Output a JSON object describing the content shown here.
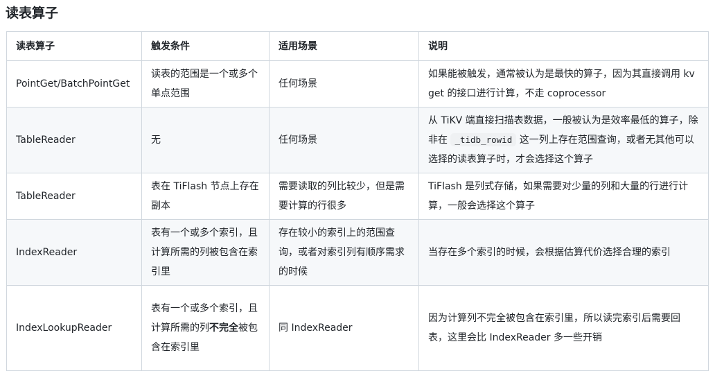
{
  "title": "读表算子",
  "headers": [
    "读表算子",
    "触发条件",
    "适用场景",
    "说明"
  ],
  "rows": [
    {
      "operator": "PointGet/BatchPointGet",
      "condition": "读表的范围是一个或多个单点范围",
      "scenario": "任何场景",
      "description": "如果能被触发，通常被认为是最快的算子，因为其直接调用 kvget 的接口进行计算，不走 coprocessor"
    },
    {
      "operator": "TableReader",
      "condition": "无",
      "scenario": "任何场景",
      "description_before": "从 TiKV 端直接扫描表数据，一般被认为是效率最低的算子，除非在 ",
      "description_code": "_tidb_rowid",
      "description_after": " 这一列上存在范围查询，或者无其他可以选择的读表算子时，才会选择这个算子"
    },
    {
      "operator": "TableReader",
      "condition": "表在 TiFlash 节点上存在副本",
      "scenario": "需要读取的列比较少，但是需要计算的行很多",
      "description": "TiFlash 是列式存储，如果需要对少量的列和大量的行进行计算，一般会选择这个算子"
    },
    {
      "operator": "IndexReader",
      "condition": "表有一个或多个索引，且计算所需的列被包含在索引里",
      "scenario": "存在较小的索引上的范围查询，或者对索引列有顺序需求的时候",
      "description": "当存在多个索引的时候，会根据估算代价选择合理的索引"
    },
    {
      "operator": "IndexLookupReader",
      "condition_before": "表有一个或多个索引，且计算所需的列",
      "condition_bold": "不完全",
      "condition_after": "被包含在索引里",
      "scenario": "同 IndexReader",
      "description": "因为计算列不完全被包含在索引里，所以读完索引后需要回表，这里会比 IndexReader 多一些开销"
    }
  ]
}
